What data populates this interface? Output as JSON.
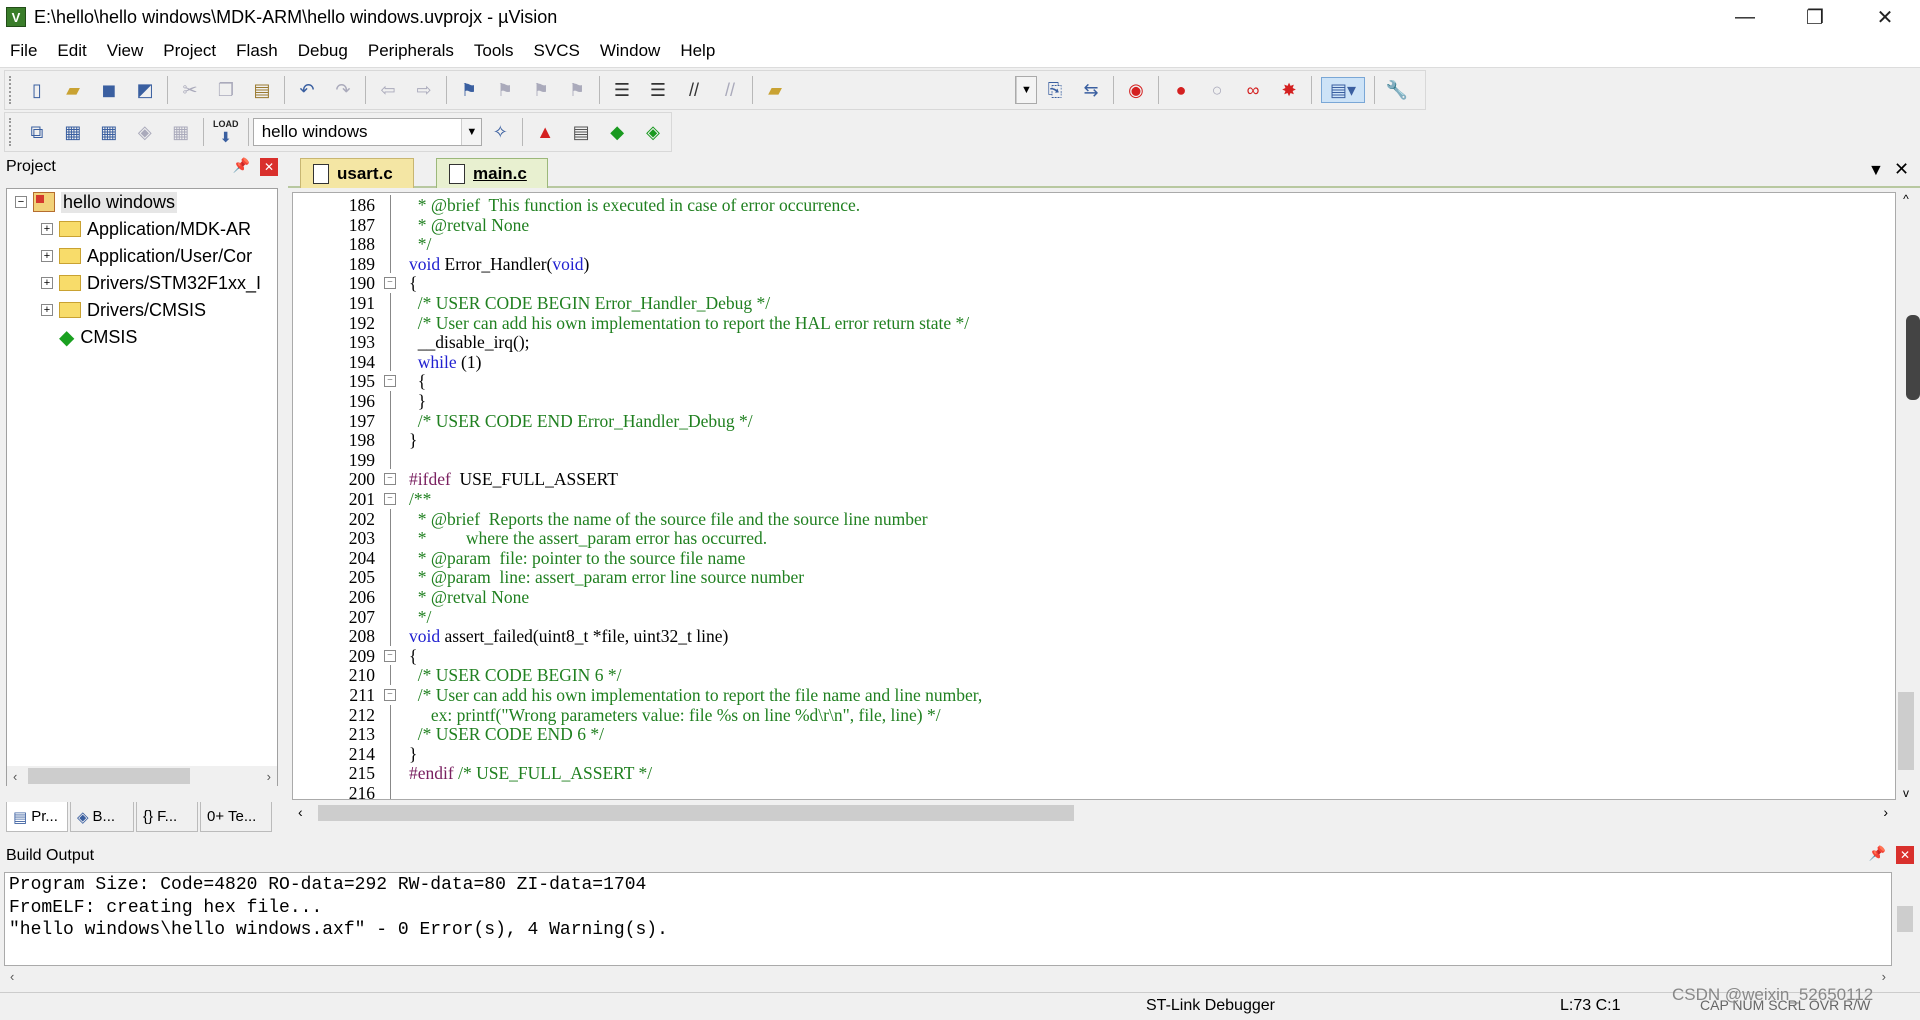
{
  "window": {
    "title": "E:\\hello\\hello windows\\MDK-ARM\\hello windows.uvprojx - µVision",
    "app_icon": "V",
    "minimize": "—",
    "maximize": "❐",
    "close": "✕"
  },
  "menu": [
    "File",
    "Edit",
    "View",
    "Project",
    "Flash",
    "Debug",
    "Peripherals",
    "Tools",
    "SVCS",
    "Window",
    "Help"
  ],
  "toolbar2": {
    "target_value": "hello windows",
    "load_label": "LOAD"
  },
  "project_panel": {
    "title": "Project",
    "root": "hello windows",
    "items": [
      {
        "label": "Application/MDK-AR"
      },
      {
        "label": "Application/User/Cor"
      },
      {
        "label": "Drivers/STM32F1xx_I"
      },
      {
        "label": "Drivers/CMSIS"
      },
      {
        "label": "CMSIS"
      }
    ],
    "tabs": [
      "Pr...",
      "B...",
      "{} F...",
      "0+ Te..."
    ]
  },
  "editor": {
    "tabs": [
      {
        "label": "usart.c",
        "active": false
      },
      {
        "label": "main.c",
        "active": true
      }
    ],
    "lines": [
      {
        "n": "186",
        "t": [
          [
            "cm",
            "  * @brief  This function is executed in case of error occurrence."
          ]
        ]
      },
      {
        "n": "187",
        "t": [
          [
            "cm",
            "  * @retval None"
          ]
        ]
      },
      {
        "n": "188",
        "t": [
          [
            "cm",
            "  */"
          ]
        ]
      },
      {
        "n": "189",
        "t": [
          [
            "kw",
            "void"
          ],
          [
            "",
            " Error_Handler("
          ],
          [
            "kw",
            "void"
          ],
          [
            "",
            ")"
          ]
        ]
      },
      {
        "n": "190",
        "fold": "−",
        "t": [
          [
            "",
            "{"
          ]
        ]
      },
      {
        "n": "191",
        "t": [
          [
            "cm",
            "  /* USER CODE BEGIN Error_Handler_Debug */"
          ]
        ]
      },
      {
        "n": "192",
        "t": [
          [
            "cm",
            "  /* User can add his own implementation to report the HAL error return state */"
          ]
        ]
      },
      {
        "n": "193",
        "t": [
          [
            "",
            "  __disable_irq();"
          ]
        ]
      },
      {
        "n": "194",
        "t": [
          [
            "kw",
            "  while"
          ],
          [
            "",
            " (1)"
          ]
        ]
      },
      {
        "n": "195",
        "fold": "−",
        "t": [
          [
            "",
            "  {"
          ]
        ]
      },
      {
        "n": "196",
        "t": [
          [
            "",
            "  }"
          ]
        ]
      },
      {
        "n": "197",
        "t": [
          [
            "cm",
            "  /* USER CODE END Error_Handler_Debug */"
          ]
        ]
      },
      {
        "n": "198",
        "t": [
          [
            "",
            "}"
          ]
        ]
      },
      {
        "n": "199",
        "t": [
          [
            "",
            ""
          ]
        ]
      },
      {
        "n": "200",
        "fold": "−",
        "t": [
          [
            "pp",
            "#ifdef"
          ],
          [
            "",
            "  USE_FULL_ASSERT"
          ]
        ]
      },
      {
        "n": "201",
        "fold": "−",
        "t": [
          [
            "cm",
            "/**"
          ]
        ]
      },
      {
        "n": "202",
        "t": [
          [
            "cm",
            "  * @brief  Reports the name of the source file and the source line number"
          ]
        ]
      },
      {
        "n": "203",
        "t": [
          [
            "cm",
            "  *         where the assert_param error has occurred."
          ]
        ]
      },
      {
        "n": "204",
        "t": [
          [
            "cm",
            "  * @param  file: pointer to the source file name"
          ]
        ]
      },
      {
        "n": "205",
        "t": [
          [
            "cm",
            "  * @param  line: assert_param error line source number"
          ]
        ]
      },
      {
        "n": "206",
        "t": [
          [
            "cm",
            "  * @retval None"
          ]
        ]
      },
      {
        "n": "207",
        "t": [
          [
            "cm",
            "  */"
          ]
        ]
      },
      {
        "n": "208",
        "t": [
          [
            "kw",
            "void"
          ],
          [
            "",
            " assert_failed(uint8_t *file, uint32_t line)"
          ]
        ]
      },
      {
        "n": "209",
        "fold": "−",
        "t": [
          [
            "",
            "{"
          ]
        ]
      },
      {
        "n": "210",
        "t": [
          [
            "cm",
            "  /* USER CODE BEGIN 6 */"
          ]
        ]
      },
      {
        "n": "211",
        "fold": "−",
        "t": [
          [
            "cm",
            "  /* User can add his own implementation to report the file name and line number,"
          ]
        ]
      },
      {
        "n": "212",
        "t": [
          [
            "cm",
            "     ex: printf(\"Wrong parameters value: file %s on line %d\\r\\n\", file, line) */"
          ]
        ]
      },
      {
        "n": "213",
        "t": [
          [
            "cm",
            "  /* USER CODE END 6 */"
          ]
        ]
      },
      {
        "n": "214",
        "t": [
          [
            "",
            "}"
          ]
        ]
      },
      {
        "n": "215",
        "t": [
          [
            "pp",
            "#endif"
          ],
          [
            "cm",
            " /* USE_FULL_ASSERT */"
          ]
        ]
      },
      {
        "n": "216",
        "t": [
          [
            "",
            ""
          ]
        ]
      }
    ]
  },
  "build_output": {
    "title": "Build Output",
    "lines": [
      "Program Size: Code=4820 RO-data=292 RW-data=80 ZI-data=1704",
      "FromELF: creating hex file...",
      "\"hello windows\\hello windows.axf\" - 0 Error(s), 4 Warning(s)."
    ]
  },
  "status": {
    "debugger": "ST-Link Debugger",
    "cursor": "L:73 C:1",
    "flags": "CAP  NUM  SCRL  OVR  R/W",
    "watermark": "CSDN @weixin_52650112"
  }
}
